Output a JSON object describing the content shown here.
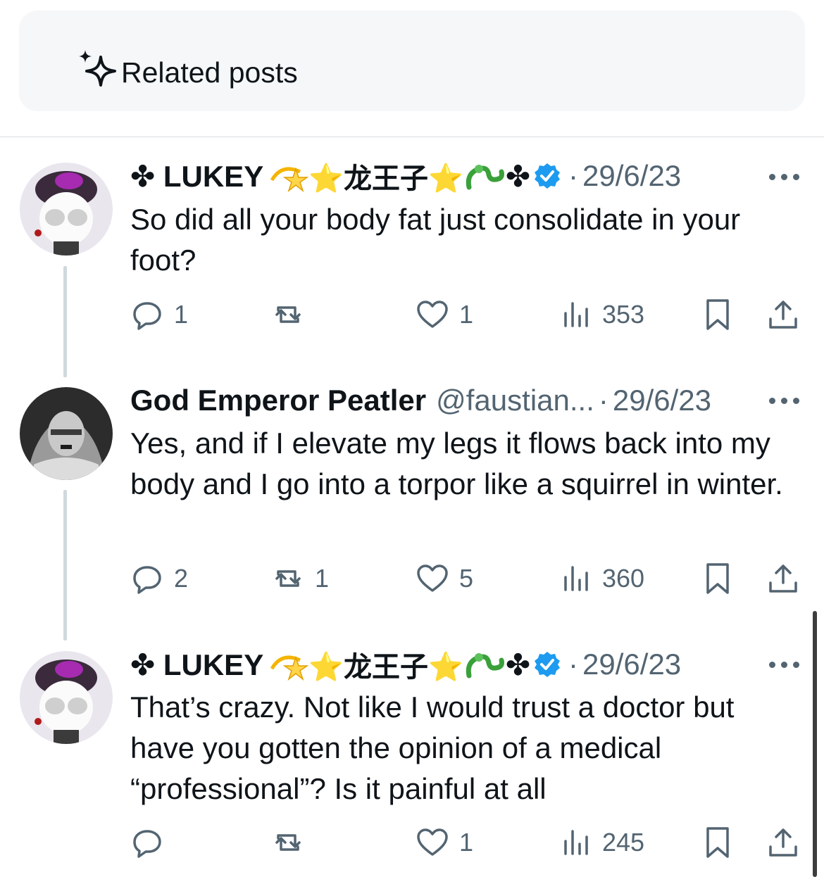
{
  "related": {
    "label": "Related posts",
    "icon": "sparkle-icon"
  },
  "tweets": [
    {
      "name": "✤ LUKEY",
      "name_suffix": "⭐龙王子⭐",
      "handle": "",
      "date": "29/6/23",
      "verified": true,
      "text": "So did all your body fat just consolidate in your foot?",
      "replies": "1",
      "reposts": "",
      "likes": "1",
      "views": "353"
    },
    {
      "name": "God Emperor Peatler",
      "name_suffix": "",
      "handle": "@faustian...",
      "date": "29/6/23",
      "verified": false,
      "text": "Yes, and if I elevate my legs it flows back into my body and I go into a torpor like a squirrel in winter.",
      "replies": "2",
      "reposts": "1",
      "likes": "5",
      "views": "360"
    },
    {
      "name": "✤ LUKEY",
      "name_suffix": "⭐龙王子⭐",
      "handle": "",
      "date": "29/6/23",
      "verified": true,
      "text": "That’s crazy. Not like I would trust a doctor but have you gotten the opinion of a medical “professional”? Is it painful at all",
      "replies": "",
      "reposts": "",
      "likes": "1",
      "views": "245"
    }
  ],
  "colors": {
    "secondary_text": "#536471",
    "verified_blue": "#1d9bf0",
    "thread_line": "#cfd9de"
  }
}
